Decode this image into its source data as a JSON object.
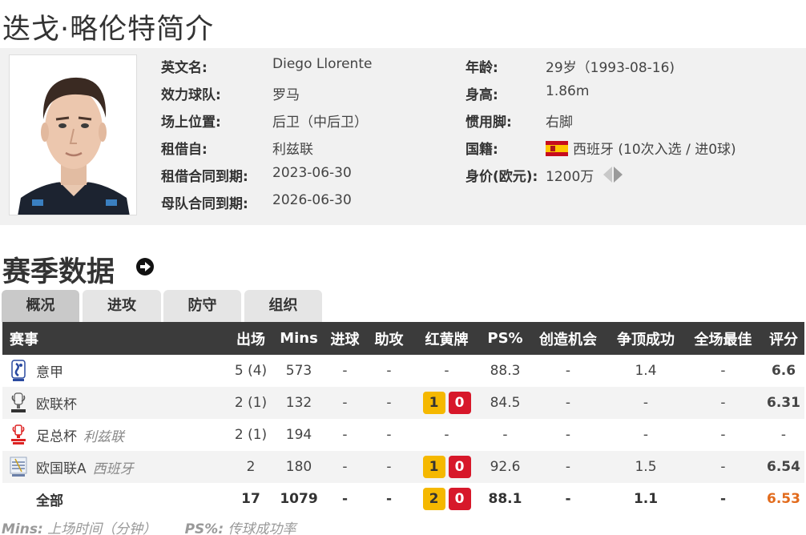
{
  "page_title": "迭戈·略伦特简介",
  "profile": {
    "left": [
      {
        "label": "英文名:",
        "value": "Diego Llorente"
      },
      {
        "label": "效力球队:",
        "value": "罗马"
      },
      {
        "label": "场上位置:",
        "value": "后卫（中后卫）"
      },
      {
        "label": "租借自:",
        "value": "利兹联"
      },
      {
        "label": "租借合同到期:",
        "value": "2023-06-30"
      },
      {
        "label": "母队合同到期:",
        "value": "2026-06-30"
      }
    ],
    "right": [
      {
        "label": "年龄:",
        "value": "29岁（1993-08-16)"
      },
      {
        "label": "身高:",
        "value": "1.86m"
      },
      {
        "label": "惯用脚:",
        "value": "右脚"
      },
      {
        "label": "国籍:",
        "value": "西班牙 (10次入选 / 进0球)"
      },
      {
        "label": "身价(欧元):",
        "value": "1200万"
      }
    ],
    "nationality_flag": "spain-flag",
    "colors": {
      "flag_red": "#c60b1e",
      "flag_yellow": "#ffc400"
    }
  },
  "section_title": "赛季数据",
  "tabs": [
    {
      "label": "概况",
      "active": true
    },
    {
      "label": "进攻",
      "active": false
    },
    {
      "label": "防守",
      "active": false
    },
    {
      "label": "组织",
      "active": false
    }
  ],
  "table": {
    "headers": [
      "赛事",
      "出场",
      "Mins",
      "进球",
      "助攻",
      "红黄牌",
      "PS%",
      "创造机会",
      "争顶成功",
      "全场最佳",
      "评分"
    ],
    "rows": [
      {
        "logo": "serie-a-logo",
        "competition": "意甲",
        "team": "",
        "apps": "5 (4)",
        "mins": "573",
        "goals": "-",
        "assists": "-",
        "cards": "-",
        "yellow": "",
        "red": "",
        "ps": "88.3",
        "chances": "-",
        "aerials": "1.4",
        "motm": "-",
        "rating": "6.6"
      },
      {
        "logo": "europa-league-logo",
        "competition": "欧联杯",
        "team": "",
        "apps": "2 (1)",
        "mins": "132",
        "goals": "-",
        "assists": "-",
        "cards": "",
        "yellow": "1",
        "red": "0",
        "ps": "84.5",
        "chances": "-",
        "aerials": "-",
        "motm": "-",
        "rating": "6.31"
      },
      {
        "logo": "fa-cup-logo",
        "competition": "足总杯",
        "team": "利兹联",
        "apps": "2 (1)",
        "mins": "194",
        "goals": "-",
        "assists": "-",
        "cards": "-",
        "yellow": "",
        "red": "",
        "ps": "-",
        "chances": "-",
        "aerials": "-",
        "motm": "-",
        "rating": "-"
      },
      {
        "logo": "nations-league-logo",
        "competition": "欧国联A",
        "team": "西班牙",
        "apps": "2",
        "mins": "180",
        "goals": "-",
        "assists": "-",
        "cards": "",
        "yellow": "1",
        "red": "0",
        "ps": "92.6",
        "chances": "-",
        "aerials": "1.5",
        "motm": "-",
        "rating": "6.54"
      }
    ],
    "total": {
      "competition": "全部",
      "apps": "17",
      "mins": "1079",
      "goals": "-",
      "assists": "-",
      "yellow": "2",
      "red": "0",
      "ps": "88.1",
      "chances": "-",
      "aerials": "1.1",
      "motm": "-",
      "rating": "6.53"
    }
  },
  "footnote": {
    "mins_key": "Mins:",
    "mins_desc": "上场时间（分钟）",
    "ps_key": "PS%:",
    "ps_desc": "传球成功率"
  },
  "colors": {
    "header_bg": "#3b3b3b",
    "rating": "#e26b1c",
    "yellow_card": "#f5b800",
    "red_card": "#d7182a"
  }
}
